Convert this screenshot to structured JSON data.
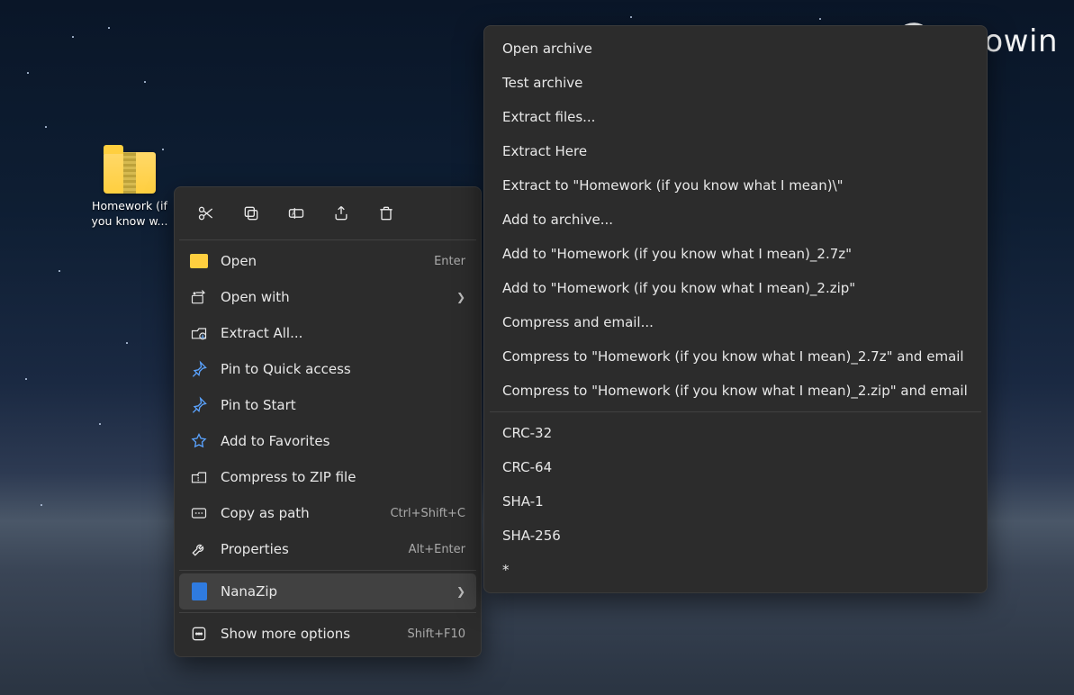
{
  "desktop": {
    "file_label": "Homework (if you know w..."
  },
  "watermark": {
    "text": "Neowin"
  },
  "context_menu": {
    "items": [
      {
        "label": "Open",
        "accel": "Enter"
      },
      {
        "label": "Open with",
        "chevron": true
      },
      {
        "label": "Extract All..."
      },
      {
        "label": "Pin to Quick access"
      },
      {
        "label": "Pin to Start"
      },
      {
        "label": "Add to Favorites"
      },
      {
        "label": "Compress to ZIP file"
      },
      {
        "label": "Copy as path",
        "accel": "Ctrl+Shift+C"
      },
      {
        "label": "Properties",
        "accel": "Alt+Enter"
      },
      {
        "label": "NanaZip",
        "chevron": true
      },
      {
        "label": "Show more options",
        "accel": "Shift+F10"
      }
    ]
  },
  "submenu": {
    "group1": [
      "Open archive",
      "Test archive",
      "Extract files...",
      "Extract Here",
      "Extract to \"Homework (if you know what I mean)\\\"",
      "Add to archive...",
      "Add to \"Homework (if you know what I mean)_2.7z\"",
      "Add to \"Homework (if you know what I mean)_2.zip\"",
      "Compress and email...",
      "Compress to \"Homework (if you know what I mean)_2.7z\" and email",
      "Compress to \"Homework (if you know what I mean)_2.zip\" and email"
    ],
    "group2": [
      "CRC-32",
      "CRC-64",
      "SHA-1",
      "SHA-256",
      "*"
    ]
  }
}
